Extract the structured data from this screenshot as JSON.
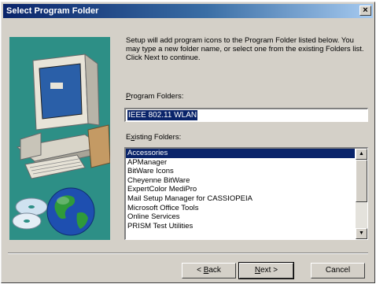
{
  "window": {
    "title": "Select Program Folder",
    "close_glyph": "×"
  },
  "intro": {
    "text": "Setup will add program icons to the Program Folder listed below. You may type a new folder name, or select one from the existing Folders list.  Click Next to continue."
  },
  "program_folders": {
    "label_mnemonic": "P",
    "label_rest": "rogram Folders:",
    "value": "IEEE 802.11 WLAN"
  },
  "existing_folders": {
    "label_first": "E",
    "label_mnemonic": "x",
    "label_rest": "isting Folders:",
    "items": [
      "Accessories",
      "APManager",
      "BitWare Icons",
      "Cheyenne BitWare",
      "ExpertColor MediPro",
      "Mail Setup Manager for CASSIOPEIA",
      "Microsoft Office Tools",
      "Online Services",
      "PRISM Test Utilities"
    ],
    "selected_index": 0
  },
  "buttons": {
    "back": {
      "pre": "< ",
      "mnemonic": "B",
      "post": "ack"
    },
    "next": {
      "mnemonic": "N",
      "post": "ext >"
    },
    "cancel": "Cancel"
  },
  "colors": {
    "title_bar": "#0a246a",
    "selection": "#0a246a",
    "dialog_face": "#d4d0c8",
    "art_panel": "#2d8f86"
  },
  "icons": {
    "computer": "computer-icon",
    "discs": "cd-discs-icon",
    "globe": "globe-icon"
  }
}
